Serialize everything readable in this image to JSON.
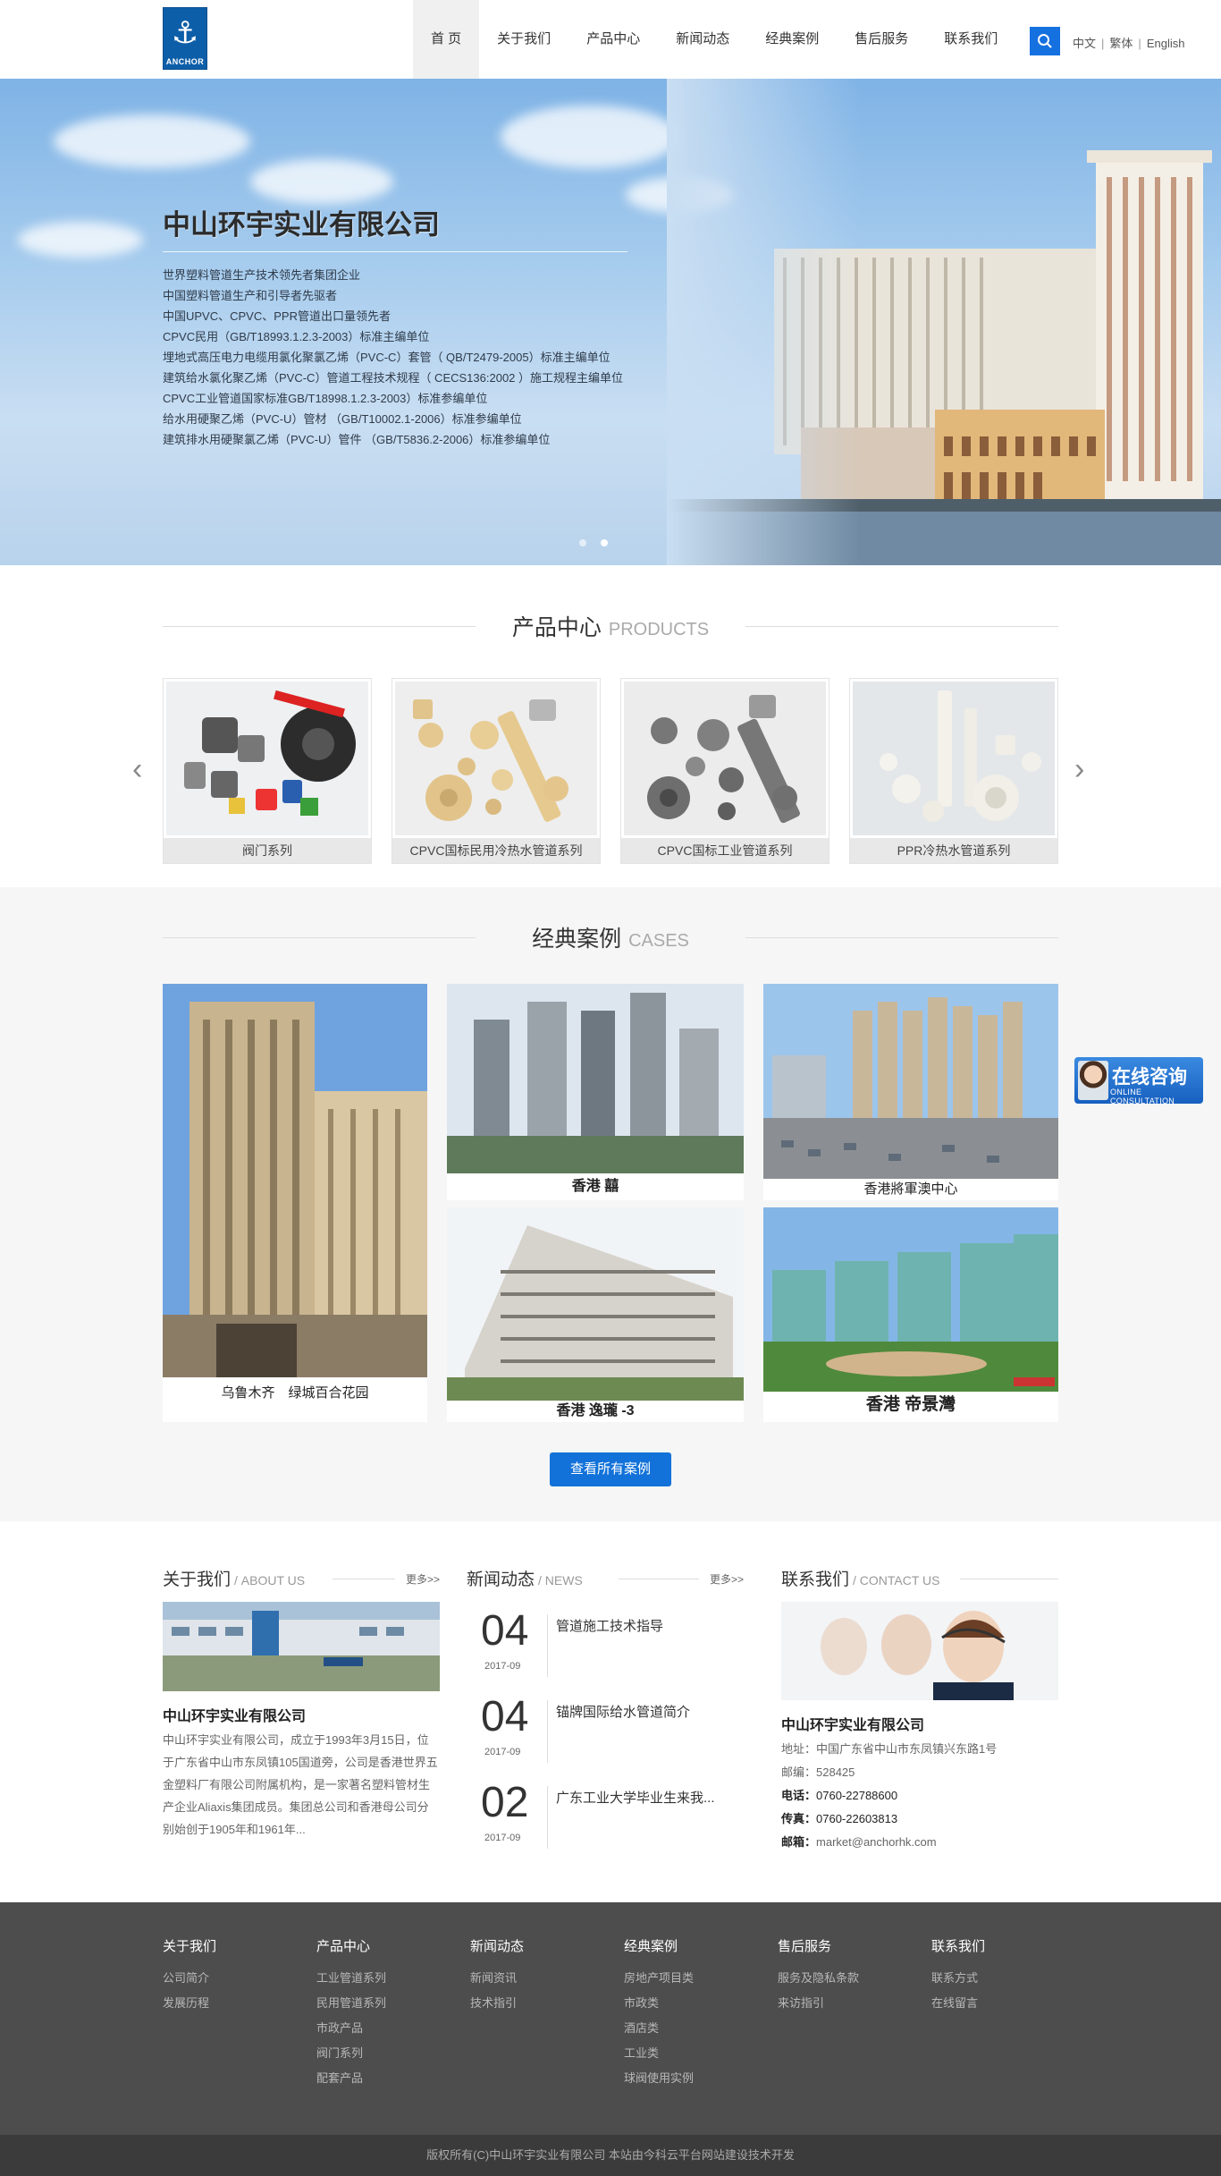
{
  "header": {
    "logo_text": "ANCHOR",
    "nav": [
      {
        "label": "首 页",
        "active": true
      },
      {
        "label": "关于我们"
      },
      {
        "label": "产品中心"
      },
      {
        "label": "新闻动态"
      },
      {
        "label": "经典案例"
      },
      {
        "label": "售后服务"
      },
      {
        "label": "联系我们"
      }
    ],
    "langs": [
      "中文",
      "繁体",
      "English"
    ]
  },
  "banner": {
    "title": "中山环宇实业有限公司",
    "lines": [
      "世界塑料管道生产技术领先者集团企业",
      "中国塑料管道生产和引导者先驱者",
      "中国UPVC、CPVC、PPR管道出口量领先者",
      "CPVC民用（GB/T18993.1.2.3-2003）标准主编单位",
      "埋地式高压电力电缆用氯化聚氯乙烯（PVC-C）套管（ QB/T2479-2005）标准主编单位",
      "建筑给水氯化聚乙烯（PVC-C）管道工程技术规程（ CECS136:2002 ）施工规程主编单位",
      "CPVC工业管道国家标准GB/T18998.1.2.3-2003）标准参编单位",
      "给水用硬聚乙烯（PVC-U）管材 （GB/T10002.1-2006）标准参编单位",
      "建筑排水用硬聚氯乙烯（PVC-U）管件 （GB/T5836.2-2006）标准参编单位"
    ]
  },
  "products": {
    "title": "产品中心",
    "title_en": "PRODUCTS",
    "items": [
      {
        "label": "阀门系列"
      },
      {
        "label": "CPVC国标民用冷热水管道系列"
      },
      {
        "label": "CPVC国标工业管道系列"
      },
      {
        "label": "PPR冷热水管道系列"
      }
    ]
  },
  "cases": {
    "title": "经典案例",
    "title_en": "CASES",
    "items": [
      {
        "label": "乌鲁木齐　绿城百合花园"
      },
      {
        "label": "香港 囍"
      },
      {
        "label": "香港將軍澳中心"
      },
      {
        "label": "香港 逸瓏 -3"
      },
      {
        "label": "香港 帝景灣"
      }
    ],
    "more_label": "查看所有案例"
  },
  "about": {
    "title": "关于我们",
    "title_en": "/ ABOUT US",
    "more": "更多>>",
    "company": "中山环宇实业有限公司",
    "text": "中山环宇实业有限公司，成立于1993年3月15日，位于广东省中山市东凤镇105国道旁，公司是香港世界五金塑料厂有限公司附属机构，是一家著名塑料管材生产企业Aliaxis集团成员。集团总公司和香港母公司分别始创于1905年和1961年..."
  },
  "news": {
    "title": "新闻动态",
    "title_en": "/ NEWS",
    "more": "更多>>",
    "items": [
      {
        "day": "04",
        "ym": "2017-09",
        "title": "管道施工技术指导"
      },
      {
        "day": "04",
        "ym": "2017-09",
        "title": "锚牌国际给水管道简介"
      },
      {
        "day": "02",
        "ym": "2017-09",
        "title": "广东工业大学毕业生来我..."
      }
    ]
  },
  "contact": {
    "title": "联系我们",
    "title_en": "/ CONTACT US",
    "company": "中山环宇实业有限公司",
    "address": "地址：中国广东省中山市东凤镇兴东路1号",
    "postcode": "邮编：528425",
    "phone_label": "电话：",
    "phone": "0760-22788600",
    "fax_label": "传真：",
    "fax": "0760-22603813",
    "email_label": "邮箱：",
    "email": "market@anchorhk.com"
  },
  "consult": {
    "cn": "在线咨询",
    "en": "ONLINE CONSULTATION"
  },
  "footer": {
    "cols": [
      {
        "h": "关于我们",
        "items": [
          "公司简介",
          "发展历程"
        ]
      },
      {
        "h": "产品中心",
        "items": [
          "工业管道系列",
          "民用管道系列",
          "市政产品",
          "阀门系列",
          "配套产品"
        ]
      },
      {
        "h": "新闻动态",
        "items": [
          "新闻资讯",
          "技术指引"
        ]
      },
      {
        "h": "经典案例",
        "items": [
          "房地产项目类",
          "市政类",
          "酒店类",
          "工业类",
          "球阀使用实例"
        ]
      },
      {
        "h": "售后服务",
        "items": [
          "服务及隐私条款",
          "来访指引"
        ]
      },
      {
        "h": "联系我们",
        "items": [
          "联系方式",
          "在线留言"
        ]
      }
    ],
    "copyright": "版权所有(C)中山环宇实业有限公司  本站由今科云平台网站建设技术开发"
  },
  "colors": {
    "accent": "#1272d9",
    "footer_bg": "#4d4d4d",
    "copyright_bg": "#3b3b3b",
    "cases_bg": "#f6f6f6"
  }
}
